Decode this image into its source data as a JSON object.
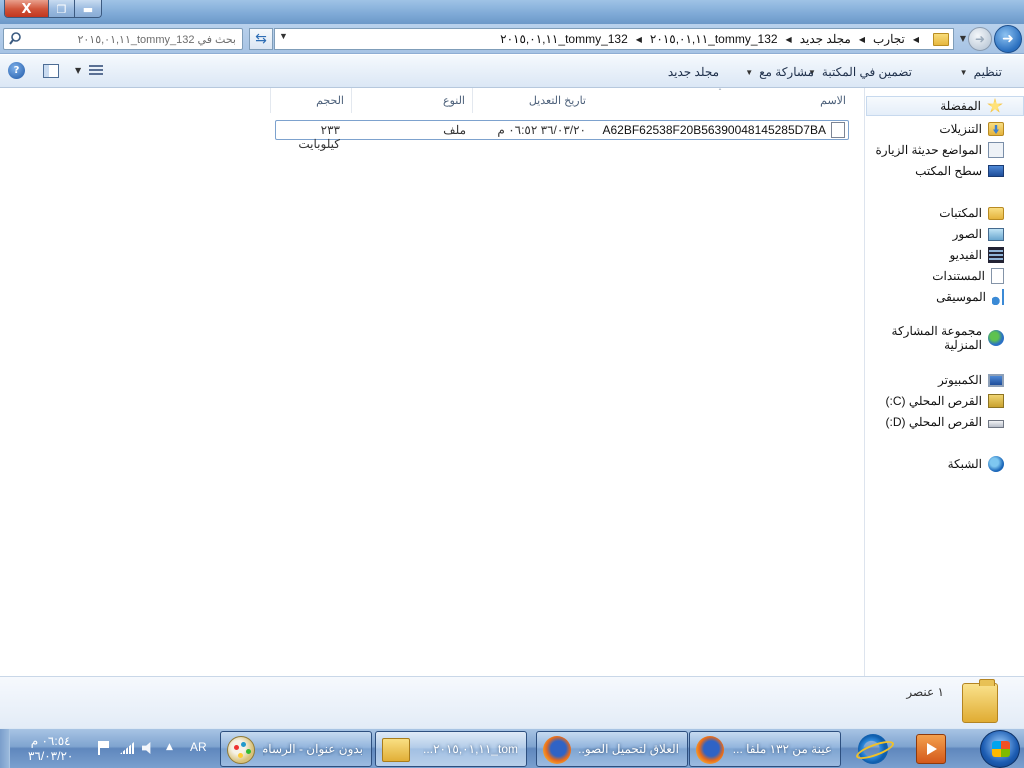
{
  "window": {
    "close": "X",
    "maximize": "❐",
    "minimize": "▬"
  },
  "addressbar": {
    "search_placeholder": "بحث في tommy_132_٢٠١٥,٠١,١١",
    "breadcrumbs": [
      "تجارب",
      "مجلد جديد",
      "tommy_132_٢٠١٥,٠١,١١",
      "tommy_132_٢٠١٥,٠١,١١"
    ]
  },
  "toolbar": {
    "organize": "تنظيم",
    "include_in_library": "تضمين في المكتبة",
    "share_with": "مشاركة مع",
    "new_folder": "مجلد جديد"
  },
  "navpane": {
    "favorites": "المفضلة",
    "downloads": "التنزيلات",
    "recent_places": "المواضع حديثة الزيارة",
    "desktop": "سطح المكتب",
    "libraries": "المكتبات",
    "pictures": "الصور",
    "videos": "الفيديو",
    "documents": "المستندات",
    "music": "الموسيقى",
    "homegroup": "مجموعة المشاركة المنزلية",
    "computer": "الكمبيوتر",
    "drive_c": "القرص المحلي (C:)",
    "drive_d": "القرص المحلي (D:)",
    "network": "الشبكة"
  },
  "filelist": {
    "columns": {
      "name": "الاسم",
      "date_modified": "تاريخ التعديل",
      "type": "النوع",
      "size": "الحجم"
    },
    "rows": [
      {
        "name": "A62BF62538F20B56390048145285D7BA",
        "date_modified": "٣٦/٠٣/٢٠ ٠٦:٥٢ م",
        "type": "ملف",
        "size": "٢٣٣ كيلوبايت"
      }
    ]
  },
  "details": {
    "item_count": "١ عنصر"
  },
  "taskbar": {
    "tasks": [
      {
        "label": "عينة من ١٣٢ ملفا ..."
      },
      {
        "label": "العلاق لتحميل الصو..."
      },
      {
        "label": "tom_٢٠١٥,٠١,١١..."
      },
      {
        "label": "بدون عنوان - الرسام"
      }
    ],
    "language": "AR",
    "clock_time": "٠٦:٥٤ م",
    "clock_date": "٣٦/٠٣/٢٠"
  }
}
